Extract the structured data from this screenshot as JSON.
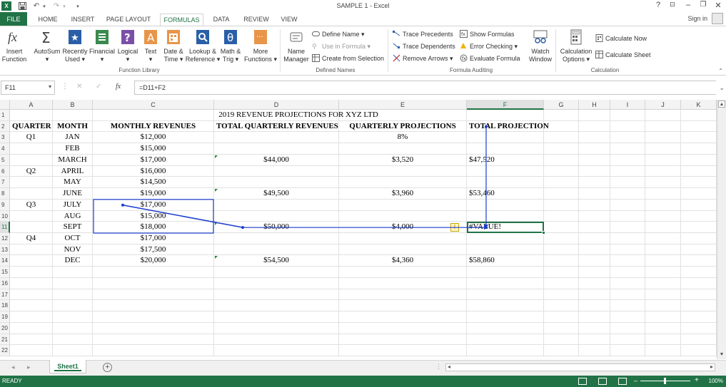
{
  "window": {
    "title": "SAMPLE 1 - Excel",
    "help": "?",
    "ribbon_display": "⊡",
    "minimize": "–",
    "restore": "❐",
    "close": "✕"
  },
  "qat": {
    "save": "💾",
    "undo": "↶",
    "redo": "↷",
    "customize": "▾"
  },
  "tabs": {
    "file": "FILE",
    "items": [
      "HOME",
      "INSERT",
      "PAGE LAYOUT",
      "FORMULAS",
      "DATA",
      "REVIEW",
      "VIEW"
    ],
    "active": "FORMULAS",
    "sign_in": "Sign in"
  },
  "ribbon": {
    "function_library": {
      "label": "Function Library",
      "insert_function": [
        "Insert",
        "Function"
      ],
      "autosum": [
        "AutoSum",
        "▾"
      ],
      "recently_used": [
        "Recently",
        "Used ▾"
      ],
      "financial": [
        "Financial",
        "▾"
      ],
      "logical": [
        "Logical",
        "▾"
      ],
      "text": [
        "Text",
        "▾"
      ],
      "date_time": [
        "Date &",
        "Time ▾"
      ],
      "lookup_reference": [
        "Lookup &",
        "Reference ▾"
      ],
      "math_trig": [
        "Math &",
        "Trig ▾"
      ],
      "more_functions": [
        "More",
        "Functions ▾"
      ]
    },
    "defined_names": {
      "label": "Defined Names",
      "name_manager": [
        "Name",
        "Manager"
      ],
      "define_name": "Define Name ▾",
      "use_in_formula": "Use in Formula ▾",
      "create_from_selection": "Create from Selection"
    },
    "formula_auditing": {
      "label": "Formula Auditing",
      "trace_precedents": "Trace Precedents",
      "trace_dependents": "Trace Dependents",
      "remove_arrows": "Remove Arrows ▾",
      "show_formulas": "Show Formulas",
      "error_checking": "Error Checking ▾",
      "evaluate_formula": "Evaluate Formula",
      "watch_window": [
        "Watch",
        "Window"
      ]
    },
    "calculation": {
      "label": "Calculation",
      "calculation_options": [
        "Calculation",
        "Options ▾"
      ],
      "calculate_now": "Calculate Now",
      "calculate_sheet": "Calculate Sheet"
    }
  },
  "formula_bar": {
    "name_box": "F11",
    "formula": "=D11+F2",
    "cancel": "✕",
    "enter": "✓",
    "fx": "fx"
  },
  "sheet": {
    "columns": [
      "A",
      "B",
      "C",
      "D",
      "E",
      "F",
      "G",
      "H",
      "I",
      "J",
      "K"
    ],
    "selected_column": "F",
    "selected_row": "11",
    "rows": [
      "1",
      "2",
      "3",
      "4",
      "5",
      "6",
      "7",
      "8",
      "9",
      "10",
      "11",
      "12",
      "13",
      "14",
      "15",
      "16",
      "17",
      "18",
      "19",
      "20",
      "21",
      "22"
    ],
    "title": "2019 REVENUE PROJECTIONS FOR XYZ LTD",
    "headers": {
      "quarter": "QUARTER",
      "month": "MONTH",
      "monthly": "MONTHLY REVENUES",
      "total_quarterly": "TOTAL QUARTERLY REVENUES",
      "quarterly_proj": "QUARTERLY PROJECTIONS",
      "total_proj": "TOTAL PROJECTION"
    },
    "data": [
      {
        "q": "Q1",
        "m": "JAN",
        "rev": "$12,000",
        "tq": "",
        "qp": "8%",
        "tp": ""
      },
      {
        "q": "",
        "m": "FEB",
        "rev": "$15,000",
        "tq": "",
        "qp": "",
        "tp": ""
      },
      {
        "q": "",
        "m": "MARCH",
        "rev": "$17,000",
        "tq": "$44,000",
        "qp": "$3,520",
        "tp": "$47,520"
      },
      {
        "q": "Q2",
        "m": "APRIL",
        "rev": "$16,000",
        "tq": "",
        "qp": "",
        "tp": ""
      },
      {
        "q": "",
        "m": "MAY",
        "rev": "$14,500",
        "tq": "",
        "qp": "",
        "tp": ""
      },
      {
        "q": "",
        "m": "JUNE",
        "rev": "$19,000",
        "tq": "$49,500",
        "qp": "$3,960",
        "tp": "$53,460"
      },
      {
        "q": "Q3",
        "m": "JULY",
        "rev": "$17,000",
        "tq": "",
        "qp": "",
        "tp": ""
      },
      {
        "q": "",
        "m": "AUG",
        "rev": "$15,000",
        "tq": "",
        "qp": "",
        "tp": ""
      },
      {
        "q": "",
        "m": "SEPT",
        "rev": "$18,000",
        "tq": "$50,000",
        "qp": "$4,000",
        "tp": "#VALUE!"
      },
      {
        "q": "Q4",
        "m": "OCT",
        "rev": "$17,000",
        "tq": "",
        "qp": "",
        "tp": ""
      },
      {
        "q": "",
        "m": "NOV",
        "rev": "$17,500",
        "tq": "",
        "qp": "",
        "tp": ""
      },
      {
        "q": "",
        "m": "DEC",
        "rev": "$20,000",
        "tq": "$54,500",
        "qp": "$4,360",
        "tp": "$58,860"
      }
    ],
    "error_icon": "!",
    "sheet_tab": "Sheet1",
    "add_sheet": "+"
  },
  "status": {
    "ready": "READY",
    "zoom": "100%",
    "zoom_minus": "–",
    "zoom_plus": "+"
  },
  "colors": {
    "brand": "#217346",
    "arrow": "#1a3ccf",
    "cell_text": "#000000"
  }
}
